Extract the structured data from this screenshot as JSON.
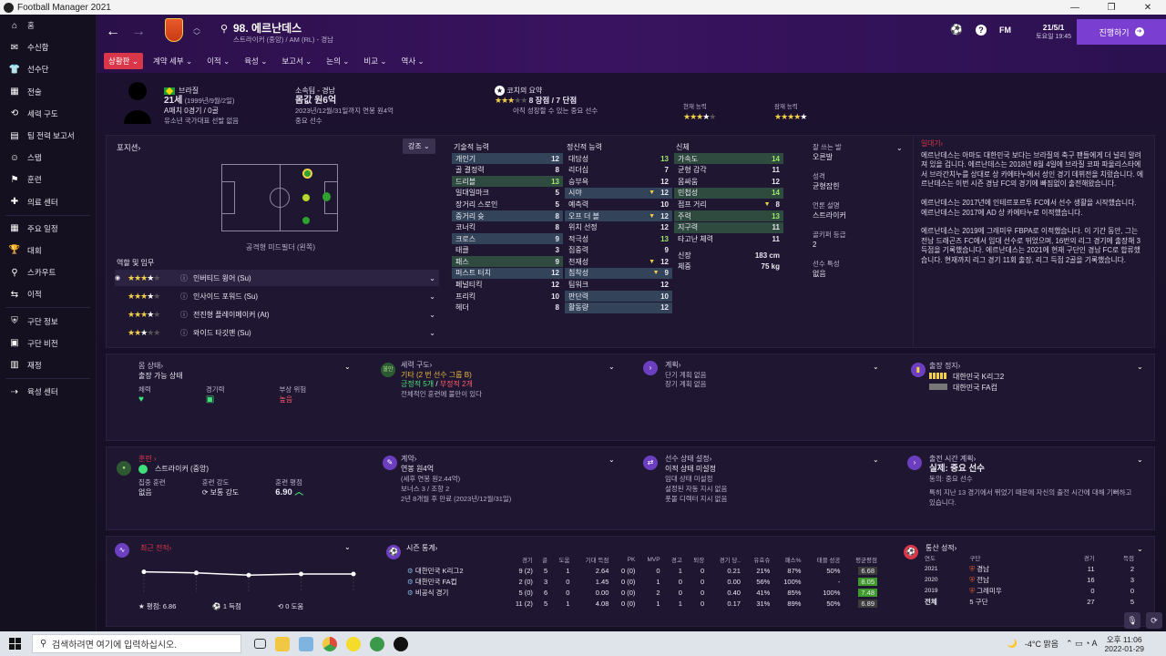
{
  "window": {
    "title": "Football Manager 2021"
  },
  "sidebar": [
    {
      "label": "홈",
      "icon": "home-icon"
    },
    {
      "label": "수신함",
      "icon": "inbox-icon"
    },
    {
      "label": "선수단",
      "icon": "squad-icon"
    },
    {
      "label": "전술",
      "icon": "tactics-icon"
    },
    {
      "label": "세력 구도",
      "icon": "dynamics-icon"
    },
    {
      "label": "팀 전력 보고서",
      "icon": "report-icon"
    },
    {
      "label": "스탭",
      "icon": "staff-icon"
    },
    {
      "label": "훈련",
      "icon": "training-icon"
    },
    {
      "label": "의료 센터",
      "icon": "medical-icon"
    },
    {
      "label": "주요 일정",
      "icon": "schedule-icon"
    },
    {
      "label": "대회",
      "icon": "trophy-icon"
    },
    {
      "label": "스카우트",
      "icon": "scout-icon"
    },
    {
      "label": "이적",
      "icon": "transfer-icon"
    },
    {
      "label": "구단 정보",
      "icon": "club-info-icon"
    },
    {
      "label": "구단 비전",
      "icon": "vision-icon"
    },
    {
      "label": "재정",
      "icon": "finance-icon"
    },
    {
      "label": "육성 센터",
      "icon": "development-icon"
    }
  ],
  "header": {
    "player_title": "98. 에르난데스",
    "player_sub": "스트라이커 (중앙) / AM (RL) - 경남",
    "date": "21/5/1",
    "time": "토요일 19:45",
    "fm_label": "FM",
    "proceed_label": "진행하기",
    "tabs": [
      "상황판",
      "계약 세부",
      "이적",
      "육성",
      "보고서",
      "논의",
      "비교",
      "역사"
    ]
  },
  "profile": {
    "nation": "브라질",
    "age": "21세",
    "birth": "(1999년/9월/2일)",
    "caps": "A매치 0경기 / 0골",
    "youth": "유소년 국가대표 선발 없음",
    "club_label": "소속팀 - 경남",
    "value": "몸값 원6억",
    "contract": "2023년/12월/31일까지 연봉 원4억",
    "status": "중요 선수",
    "coach_title": "코치의 요약",
    "coach_rating": "8 장점 / 7 단점",
    "coach_note": "아직 성장할 수 있는 중요 선수",
    "current_ability_label": "현재 능력",
    "potential_ability_label": "잠재 능력",
    "current_stars": 3.5,
    "potential_stars": 4.5
  },
  "position": {
    "label": "포지션",
    "strength_btn": "강조",
    "position_name": "공격형 미드필더 (왼쪽)",
    "roles_title": "역할 및 임무",
    "roles": [
      {
        "name": "인버티드 윙어 (Su)",
        "stars": 3.5
      },
      {
        "name": "인사이드 포워드 (Su)",
        "stars": 3.5
      },
      {
        "name": "전진형 플레이메이커 (At)",
        "stars": 3.5
      },
      {
        "name": "와이드 타깃맨 (Su)",
        "stars": 2.5
      }
    ]
  },
  "technical": {
    "title": "기술적 능력",
    "rows": [
      {
        "name": "개인기",
        "v": "12",
        "hl": "b"
      },
      {
        "name": "골 결정력",
        "v": "8",
        "hl": ""
      },
      {
        "name": "드리블",
        "v": "13",
        "hl": "g"
      },
      {
        "name": "일대일마크",
        "v": "5",
        "hl": ""
      },
      {
        "name": "장거리 스로인",
        "v": "5",
        "hl": ""
      },
      {
        "name": "중거리 슛",
        "v": "8",
        "hl": "b"
      },
      {
        "name": "코너킥",
        "v": "8",
        "hl": ""
      },
      {
        "name": "크로스",
        "v": "9",
        "hl": "b"
      },
      {
        "name": "태클",
        "v": "3",
        "hl": ""
      },
      {
        "name": "패스",
        "v": "9",
        "hl": "g"
      },
      {
        "name": "퍼스트 터치",
        "v": "12",
        "hl": "b"
      },
      {
        "name": "페널티킥",
        "v": "12",
        "hl": ""
      },
      {
        "name": "프리킥",
        "v": "10",
        "hl": ""
      },
      {
        "name": "헤더",
        "v": "8",
        "hl": ""
      }
    ]
  },
  "mental": {
    "title": "정신적 능력",
    "rows": [
      {
        "name": "대담성",
        "v": "13",
        "hl": "",
        "arrow": false
      },
      {
        "name": "리더십",
        "v": "7",
        "hl": "",
        "arrow": false
      },
      {
        "name": "승부욕",
        "v": "12",
        "hl": "",
        "arrow": false
      },
      {
        "name": "시야",
        "v": "12",
        "hl": "b",
        "arrow": true
      },
      {
        "name": "예측력",
        "v": "10",
        "hl": "",
        "arrow": false
      },
      {
        "name": "오프 더 볼",
        "v": "12",
        "hl": "b",
        "arrow": true
      },
      {
        "name": "위치 선정",
        "v": "12",
        "hl": "",
        "arrow": false
      },
      {
        "name": "적극성",
        "v": "13",
        "hl": "",
        "arrow": false
      },
      {
        "name": "집중력",
        "v": "9",
        "hl": "",
        "arrow": false
      },
      {
        "name": "천재성",
        "v": "12",
        "hl": "",
        "arrow": true
      },
      {
        "name": "침착성",
        "v": "9",
        "hl": "b",
        "arrow": true
      },
      {
        "name": "팀워크",
        "v": "12",
        "hl": "",
        "arrow": false
      },
      {
        "name": "판단력",
        "v": "10",
        "hl": "b",
        "arrow": false
      },
      {
        "name": "활동량",
        "v": "12",
        "hl": "b",
        "arrow": false
      }
    ]
  },
  "physical": {
    "title": "신체",
    "rows": [
      {
        "name": "가속도",
        "v": "14",
        "hl": "g",
        "arrow": false
      },
      {
        "name": "균형 감각",
        "v": "11",
        "hl": "",
        "arrow": false
      },
      {
        "name": "몸싸움",
        "v": "12",
        "hl": "",
        "arrow": false
      },
      {
        "name": "민첩성",
        "v": "14",
        "hl": "g",
        "arrow": false
      },
      {
        "name": "점프 거리",
        "v": "8",
        "hl": "",
        "arrow": true
      },
      {
        "name": "주력",
        "v": "13",
        "hl": "g",
        "arrow": false
      },
      {
        "name": "지구력",
        "v": "11",
        "hl": "g",
        "arrow": false
      },
      {
        "name": "타고난 체력",
        "v": "11",
        "hl": "",
        "arrow": false
      }
    ],
    "height_label": "신장",
    "height": "183 cm",
    "weight_label": "체중",
    "weight": "75 kg"
  },
  "traits": {
    "foot_label": "잘 쓰는 발",
    "foot": "오른발",
    "personality_label": "성격",
    "personality": "균형잡힌",
    "media_label": "언론 설명",
    "media": "스트라이커",
    "gk_label": "골키퍼 등급",
    "gk": "2",
    "ppm_label": "선수 특성",
    "ppm": "없음"
  },
  "bio": {
    "title": "일대기",
    "p1": "에르난데스는 아마도 대한민국 보다는 브라질의 축구 팬들에게 더 널리 알려져 있을 겁니다. 에르난데스는 2018년 8월 4일에 브라질 코파 파울리스타에서 브라간치누를 상대로 상 카에타누에서 성인 경기 데뷔전을 치렀습니다. 에르난데스는 이번 시즌 경남 FC의 경기에 빠짐없이 출전해왔습니다.",
    "p2": "에르난데스는 2017년에 인테르포르투 FC에서 선수 생활을 시작했습니다. 에르난데스는 2017에 AD 상 카에타누로 이적했습니다.",
    "p3": "에르난데스는 2019에 그레미우 FBPA로 이적했습니다. 이 기간 동안, 그는 전남 드래곤즈 FC에서 임대 선수로 뛰었으며, 16번의 리그 경기에 출장해 3득점을 기록했습니다. 에르난데스는 2021에 현재 구단인 경남 FC로 합류했습니다. 현재까지 리그 경기 11회 출장, 리그 득점 2골을 기록했습니다."
  },
  "cards": {
    "condition": {
      "title": "몸 상태",
      "value": "출장 가능 상태",
      "c1": "체력",
      "c2": "경기력",
      "c3": "부상 위험",
      "c3v": "높음"
    },
    "dynamics": {
      "title": "세력 구도",
      "group": "기타 (2 번 선수 그룹 B)",
      "pos": "긍정적 5개",
      "neg": "부정적 2개",
      "note": "전체적인 훈련에 불만이 있다",
      "badge": "불만"
    },
    "plans": {
      "title": "계획",
      "short": "단기 계획 없음",
      "long": "장기 계획 없음"
    },
    "suspension": {
      "title": "출장 정지",
      "l1": "대한민국 K리그2",
      "l2": "대한민국 FA컵"
    },
    "training": {
      "title": "훈련",
      "role": "스트라이커 (중앙)",
      "focus_label": "집중 훈련",
      "focus": "없음",
      "intensity_label": "훈련 강도",
      "intensity": "보통 강도",
      "rating_label": "훈련 평점",
      "rating": "6.90"
    },
    "contract": {
      "title": "계약",
      "wage": "연봉 원4억",
      "after_tax": "(세후 연봉 원2.44억)",
      "bonus": "보너스 3 / 조항 2",
      "expire": "2년 8개월 후 만료 (2023년/12월/31일)"
    },
    "status": {
      "title": "선수 상태 설정",
      "transfer": "이적 상태 미설정",
      "loan": "임대 상태 미설정",
      "l3": "설정된 자동 지시 없음",
      "l4": "풋볼 디렉터 지시 없음"
    },
    "playtime": {
      "title": "출전 시간 계획",
      "value": "실제: 중요 선수",
      "agree": "동의: 중요 선수",
      "note": "특히 지난 13 경기에서 뛰었기 때문에 자신의 출전 시간에 대해 기뻐하고 있습니다."
    }
  },
  "recent_form": {
    "title": "최근 전적",
    "avg_label": "평점: 6.86",
    "goals_label": "1 득점",
    "assists_label": "0 도움",
    "form_values": [
      7.2,
      7.1,
      6.9,
      7.0,
      7.0
    ]
  },
  "season_stats": {
    "title": "시즌 통계",
    "headers": [
      "경기",
      "골",
      "도움",
      "기대 득점",
      "PK",
      "MVP",
      "경고",
      "퇴장",
      "경기 당..",
      "유효슈",
      "패스%",
      "태클 성공",
      "평균평점"
    ],
    "rows": [
      {
        "comp": "대한민국 K리그2",
        "vals": [
          "9 (2)",
          "5",
          "1",
          "2.64",
          "0 (0)",
          "0",
          "1",
          "0",
          "0.21",
          "21%",
          "87%",
          "50%",
          "6.68"
        ],
        "rating_color": "#3b3b3b"
      },
      {
        "comp": "대한민국 FA컵",
        "vals": [
          "2 (0)",
          "3",
          "0",
          "1.45",
          "0 (0)",
          "1",
          "0",
          "0",
          "0.00",
          "56%",
          "100%",
          "-",
          "8.05"
        ],
        "rating_color": "#3e9a2a"
      },
      {
        "comp": "비공식 경기",
        "vals": [
          "5 (0)",
          "6",
          "0",
          "0.00",
          "0 (0)",
          "2",
          "0",
          "0",
          "0.40",
          "41%",
          "85%",
          "100%",
          "7.48"
        ],
        "rating_color": "#3e9a2a"
      }
    ],
    "total": [
      "11 (2)",
      "5",
      "1",
      "4.08",
      "0 (0)",
      "1",
      "1",
      "0",
      "0.17",
      "31%",
      "89%",
      "50%",
      "6.89"
    ]
  },
  "career": {
    "title": "통산 성적",
    "h_year": "연도",
    "h_club": "구단",
    "h_apps": "경기",
    "h_goals": "득점",
    "rows": [
      {
        "year": "2021",
        "club": "경남",
        "apps": "11",
        "goals": "2"
      },
      {
        "year": "2020",
        "club": "전남",
        "apps": "16",
        "goals": "3"
      },
      {
        "year": "2019",
        "club": "그레미우",
        "apps": "0",
        "goals": "0"
      }
    ],
    "total_label": "전체",
    "total_clubs": "5 구단",
    "total_apps": "27",
    "total_goals": "5"
  },
  "taskbar": {
    "search_placeholder": "검색하려면 여기에 입력하십시오.",
    "weather": "-4°C 맑음",
    "time": "오후 11:06",
    "date": "2022-01-29"
  }
}
